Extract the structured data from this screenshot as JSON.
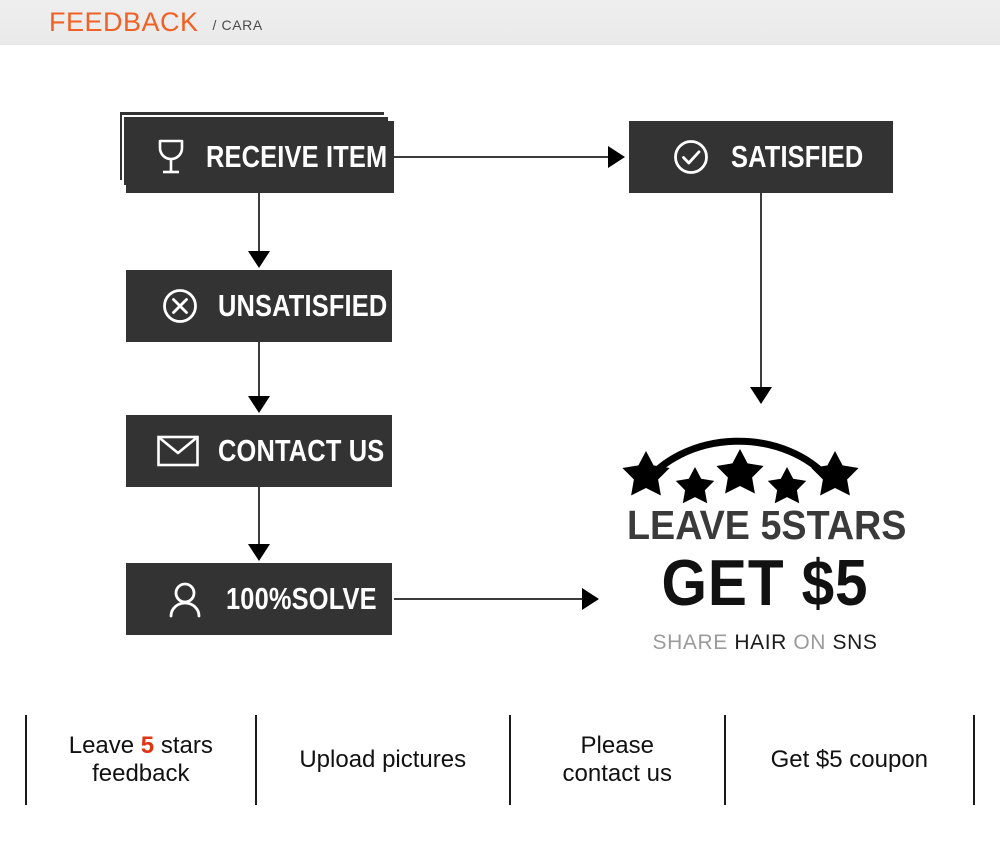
{
  "header": {
    "title": "FEEDBACK",
    "subtitle": "/ CARA",
    "accent_color": "#ef6124",
    "background_color": "#ececec"
  },
  "flow": {
    "node_color": "#333333",
    "node_text_color": "#ffffff",
    "nodes": [
      {
        "id": "receive-item",
        "label": "RECEIVE ITEM",
        "icon": "wine-glass-icon",
        "stacked": true
      },
      {
        "id": "satisfied",
        "label": "SATISFIED",
        "icon": "check-circle-icon",
        "stacked": false
      },
      {
        "id": "unsatisfied",
        "label": "UNSATISFIED",
        "icon": "x-circle-icon",
        "stacked": false
      },
      {
        "id": "contact-us",
        "label": "CONTACT US",
        "icon": "envelope-icon",
        "stacked": false
      },
      {
        "id": "solve",
        "label": "100%SOLVE",
        "icon": "person-icon",
        "stacked": false
      }
    ],
    "connectors": [
      {
        "from": "receive-item",
        "to": "satisfied",
        "direction": "right"
      },
      {
        "from": "receive-item",
        "to": "unsatisfied",
        "direction": "down"
      },
      {
        "from": "unsatisfied",
        "to": "contact-us",
        "direction": "down"
      },
      {
        "from": "contact-us",
        "to": "solve",
        "direction": "down"
      },
      {
        "from": "satisfied",
        "to": "promo",
        "direction": "down"
      },
      {
        "from": "solve",
        "to": "promo",
        "direction": "right"
      }
    ]
  },
  "promo": {
    "stars_count": 5,
    "icon": "five-stars-arc-icon",
    "line1": "LEAVE 5STARS",
    "line2": "GET $5",
    "share_line": {
      "share": "SHARE",
      "hair": "HAIR",
      "on": "ON",
      "sns": "SNS"
    }
  },
  "bottom_bar": {
    "highlight_color": "#e03416",
    "cells": [
      {
        "id": "leave-5-stars-feedback",
        "pre": "Leave ",
        "highlight": "5",
        "post": " stars",
        "line2": "feedback"
      },
      {
        "id": "upload-pictures",
        "pre": "Upload pictures",
        "highlight": "",
        "post": "",
        "line2": ""
      },
      {
        "id": "please-contact-us",
        "pre": "Please",
        "highlight": "",
        "post": "",
        "line2": "contact us"
      },
      {
        "id": "get-5-coupon",
        "pre": "Get $5 coupon",
        "highlight": "",
        "post": "",
        "line2": ""
      }
    ]
  }
}
